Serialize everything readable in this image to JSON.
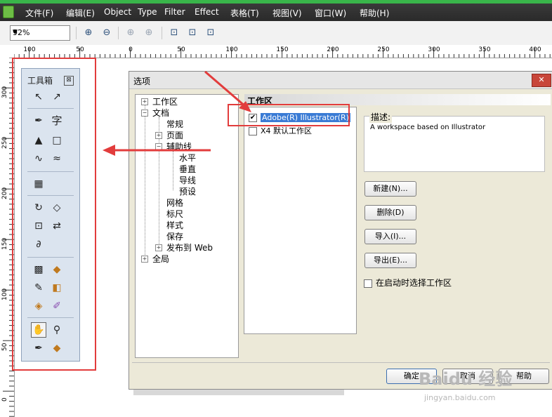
{
  "menu": {
    "items": [
      "文件(F)",
      "编辑(E)",
      "Object",
      "Type",
      "Filter",
      "Effect",
      "表格(T)",
      "视图(V)",
      "窗口(W)",
      "帮助(H)"
    ]
  },
  "toolbar": {
    "zoom_value": "92%",
    "icons": [
      "zoom-in-icon",
      "zoom-out-icon",
      "zoom-selected-icon",
      "zoom-all-icon",
      "zoom-page-icon",
      "zoom-width-icon",
      "zoom-height-icon"
    ]
  },
  "rulers": {
    "horizontal": [
      "100",
      "50",
      "0",
      "50",
      "100",
      "150",
      "200",
      "250",
      "300",
      "350",
      "400"
    ],
    "vertical": [
      "300",
      "250",
      "200",
      "150",
      "100",
      "50",
      "0"
    ]
  },
  "toolbox": {
    "title": "工具箱",
    "close_glyph": "⊠"
  },
  "dialog": {
    "title": "选项",
    "close_glyph": "✕",
    "tree": [
      {
        "label": "工作区",
        "expander": "+"
      },
      {
        "label": "文档",
        "expander": "−"
      },
      {
        "label": "常规"
      },
      {
        "label": "页面",
        "expander": "+"
      },
      {
        "label": "辅助线",
        "expander": "−"
      },
      {
        "label": "水平"
      },
      {
        "label": "垂直"
      },
      {
        "label": "导线"
      },
      {
        "label": "预设"
      },
      {
        "label": "网格"
      },
      {
        "label": "标尺"
      },
      {
        "label": "样式"
      },
      {
        "label": "保存"
      },
      {
        "label": "发布到 Web",
        "expander": "+"
      },
      {
        "label": "全局",
        "expander": "+"
      }
    ],
    "section_header": "工作区",
    "workspaces": [
      {
        "label": "Adobe(R) Illustrator(R)",
        "checked": true,
        "check_glyph": "✔"
      },
      {
        "label": "X4 默认工作区",
        "checked": false,
        "check_glyph": ""
      }
    ],
    "description_label": "描述:",
    "description_text": "A workspace based on Illustrator",
    "buttons": {
      "new": "新建(N)...",
      "delete": "删除(D)",
      "import": "导入(I)...",
      "export": "导出(E)...",
      "ok": "确定",
      "cancel": "取消",
      "help": "帮助"
    },
    "startup_label": "在启动时选择工作区"
  },
  "watermark": {
    "main": "Baidu 经验",
    "sub": "jingyan.baidu.com"
  },
  "colors": {
    "highlight": "#e23c3c",
    "selection": "#3a7bd5"
  }
}
